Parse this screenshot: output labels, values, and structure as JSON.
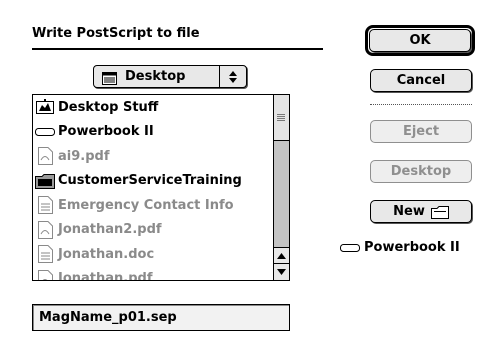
{
  "dialog": {
    "title": "Write PostScript to file",
    "location_popup": {
      "selected": "Desktop",
      "icon": "desktop-icon"
    },
    "file_list": {
      "items": [
        {
          "label": "Desktop Stuff",
          "icon": "folder-tree-icon",
          "enabled": true
        },
        {
          "label": "Powerbook II",
          "icon": "drive-icon",
          "enabled": true
        },
        {
          "label": "ai9.pdf",
          "icon": "pdf-document-icon",
          "enabled": false
        },
        {
          "label": "CustomerServiceTraining",
          "icon": "folder-icon",
          "enabled": true
        },
        {
          "label": "Emergency Contact Info",
          "icon": "document-icon",
          "enabled": false
        },
        {
          "label": "Jonathan2.pdf",
          "icon": "pdf-document-icon",
          "enabled": false
        },
        {
          "label": "Jonathan.doc",
          "icon": "document-icon",
          "enabled": false
        },
        {
          "label": "Jonathan.pdf",
          "icon": "pdf-document-icon",
          "enabled": false
        }
      ]
    },
    "filename": "MagName_p01.sep",
    "buttons": {
      "ok": "OK",
      "cancel": "Cancel",
      "eject": "Eject",
      "desktop": "Desktop",
      "new": "New"
    },
    "current_volume": {
      "label": "Powerbook II",
      "icon": "drive-icon"
    }
  }
}
